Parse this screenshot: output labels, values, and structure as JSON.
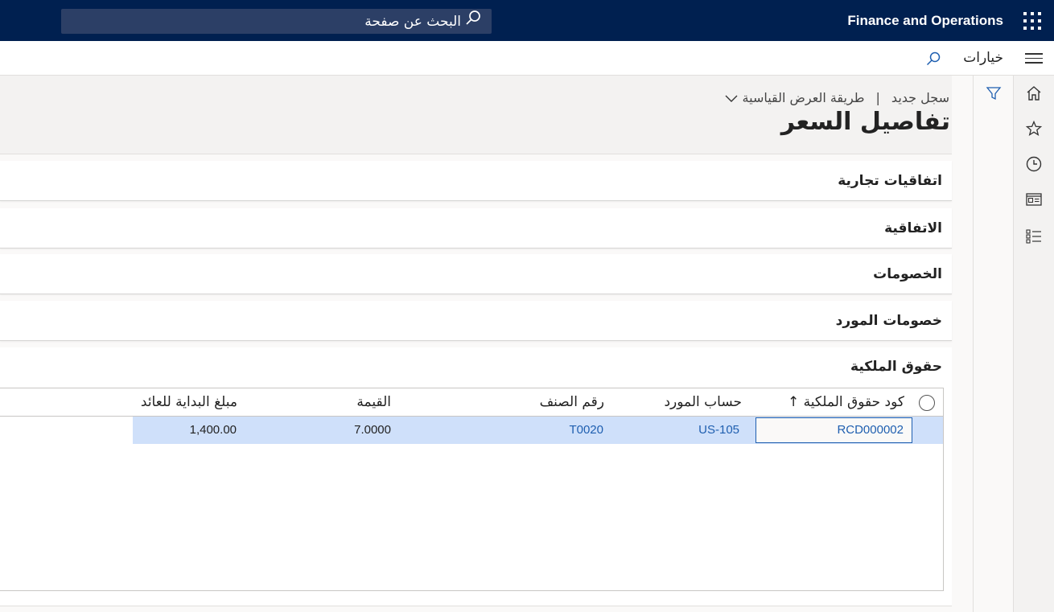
{
  "app": {
    "title": "Finance and Operations"
  },
  "search": {
    "placeholder": "البحث عن صفحة"
  },
  "actionbar": {
    "options_label": "خيارات"
  },
  "breadcrumb": {
    "new_record": "سجل جديد",
    "separator": "|",
    "view": "طريقة العرض القياسية"
  },
  "page": {
    "title": "تفاصيل السعر"
  },
  "fasttabs": [
    {
      "label": "اتفاقيات تجارية"
    },
    {
      "label": "الاتفاقية"
    },
    {
      "label": "الخصومات"
    },
    {
      "label": "خصومات المورد"
    }
  ],
  "royalty": {
    "label": "حقوق الملكية",
    "columns": {
      "code": "كود حقوق الملكية ↑",
      "vendor": "حساب المورد",
      "item": "رقم الصنف",
      "value": "القيمة",
      "start_amount": "مبلغ البداية للعائد"
    },
    "rows": [
      {
        "code": "RCD000002",
        "vendor": "US-105",
        "item": "T0020",
        "value": "7.0000",
        "start_amount": "1,400.00"
      }
    ]
  },
  "icons": {
    "waffle": "app-launcher-icon",
    "search": "search-icon",
    "hamburger": "hamburger-menu-icon",
    "filter": "filter-icon",
    "home": "home-icon",
    "favorites": "star-icon",
    "recent": "clock-icon",
    "workspaces": "workspace-icon",
    "modules": "modules-list-icon"
  },
  "colors": {
    "topbar": "#002050",
    "selected_row": "#cfe0fa",
    "link": "#1f5fb0"
  }
}
